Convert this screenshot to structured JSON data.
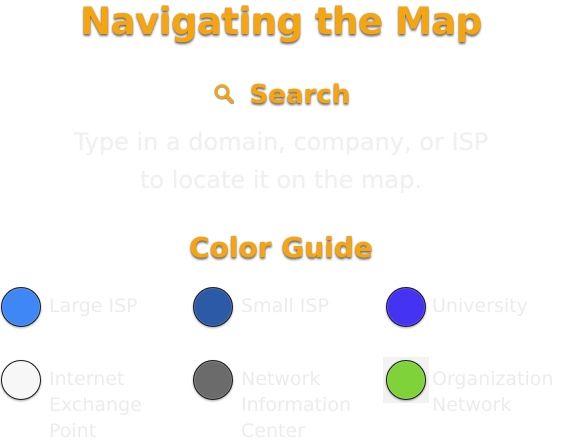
{
  "title": "Navigating the Map",
  "search": {
    "icon": "search-icon",
    "label": "Search",
    "description_line1": "Type in a domain, company, or ISP",
    "description_line2": "to locate it on the map."
  },
  "color_guide": {
    "title": "Color Guide",
    "items": [
      {
        "key": "large-isp",
        "label_lines": [
          "Large ISP"
        ],
        "color": "#3f87f5"
      },
      {
        "key": "small-isp",
        "label_lines": [
          "Small ISP"
        ],
        "color": "#2c5aa6"
      },
      {
        "key": "university",
        "label_lines": [
          "University"
        ],
        "color": "#4433f2"
      },
      {
        "key": "internet-exchange-point",
        "label_lines": [
          "Internet",
          "Exchange",
          "Point"
        ],
        "color": "#f7f7f7"
      },
      {
        "key": "network-information-center",
        "label_lines": [
          "Network",
          "Information",
          "Center"
        ],
        "color": "#6b6b6b"
      },
      {
        "key": "organization-network",
        "label_lines": [
          "Organization",
          "Network"
        ],
        "color": "#7fd23a"
      }
    ]
  },
  "colors": {
    "heading": "#f5a412",
    "light_text": "#ececec"
  }
}
